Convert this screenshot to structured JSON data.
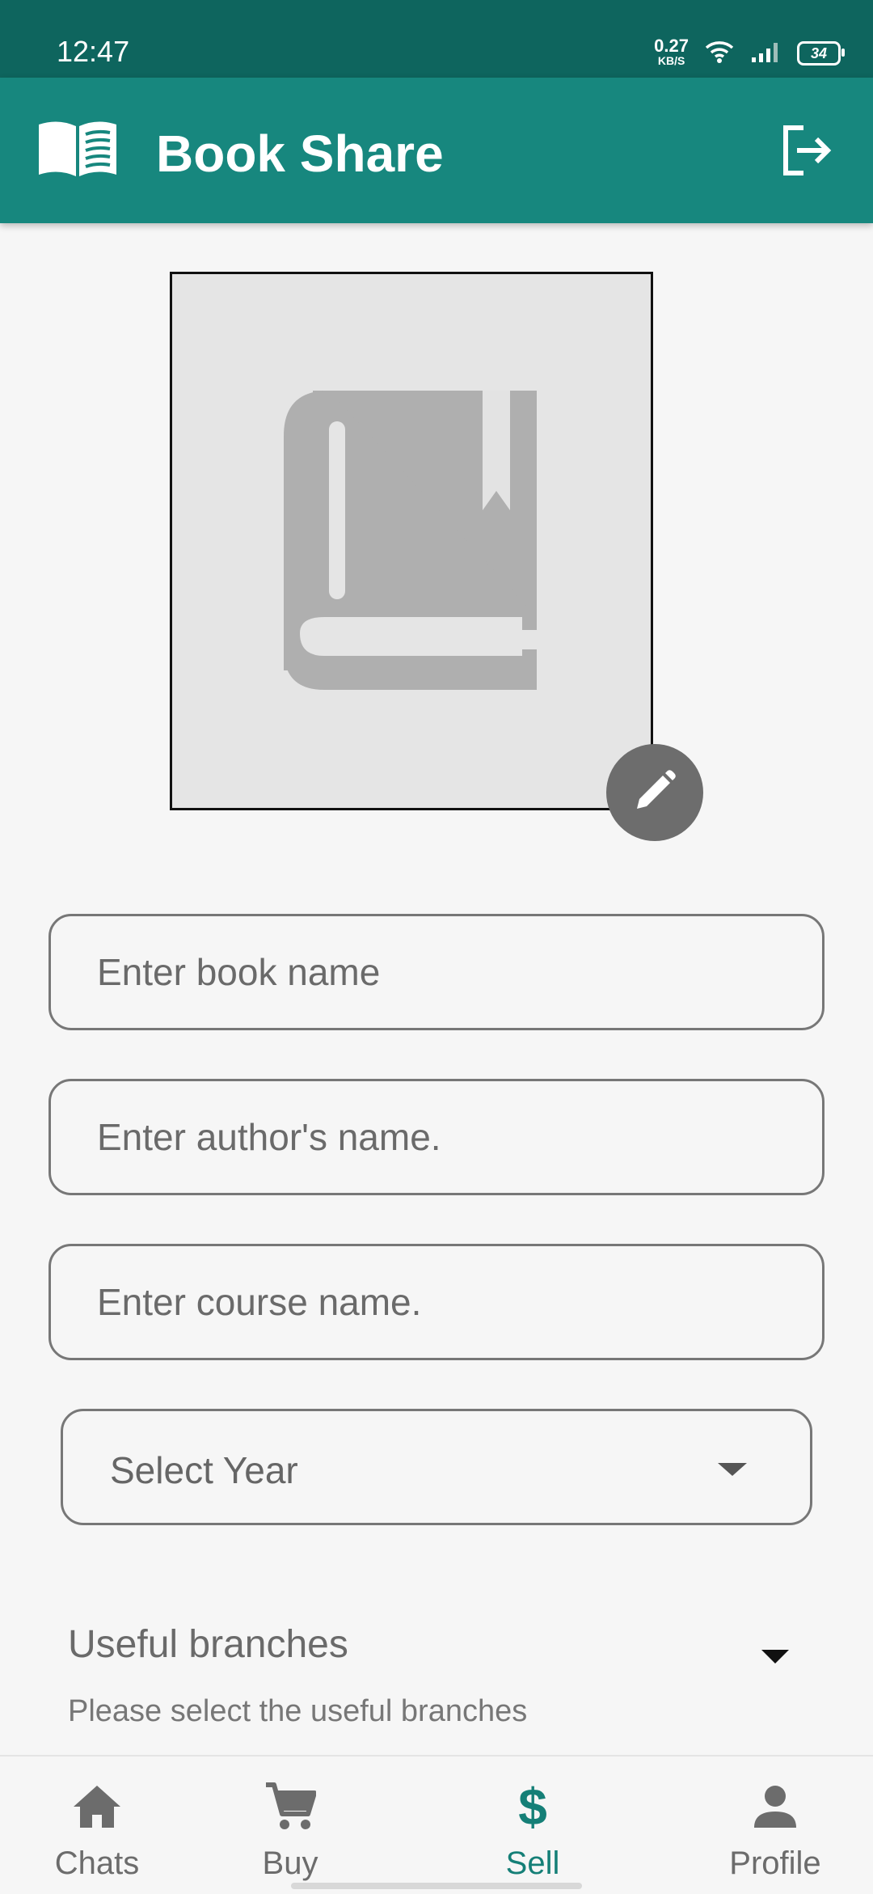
{
  "status_bar": {
    "time": "12:47",
    "net_speed_value": "0.27",
    "net_speed_unit": "KB/S",
    "battery": "34"
  },
  "app_bar": {
    "title": "Book Share",
    "logo_icon": "open-book-icon",
    "action_icon": "logout-icon"
  },
  "photo": {
    "placeholder_icon": "book-icon",
    "edit_icon": "pencil-icon"
  },
  "form": {
    "book_name_placeholder": "Enter book name",
    "author_placeholder": "Enter author's name.",
    "course_placeholder": "Enter course name.",
    "year_select_label": "Select Year",
    "branches_title": "Useful branches",
    "branches_hint": "Please select the useful branches"
  },
  "bottom_nav": {
    "items": [
      {
        "label": "Chats",
        "icon": "home-icon"
      },
      {
        "label": "Buy",
        "icon": "cart-icon"
      },
      {
        "label": "Sell",
        "icon": "dollar-icon",
        "active": true
      },
      {
        "label": "Profile",
        "icon": "person-icon"
      }
    ],
    "sell_symbol": "$"
  },
  "colors": {
    "status_bar": "#0e655e",
    "app_bar": "#17877e",
    "accent": "#157f77",
    "background": "#f6f6f6"
  }
}
